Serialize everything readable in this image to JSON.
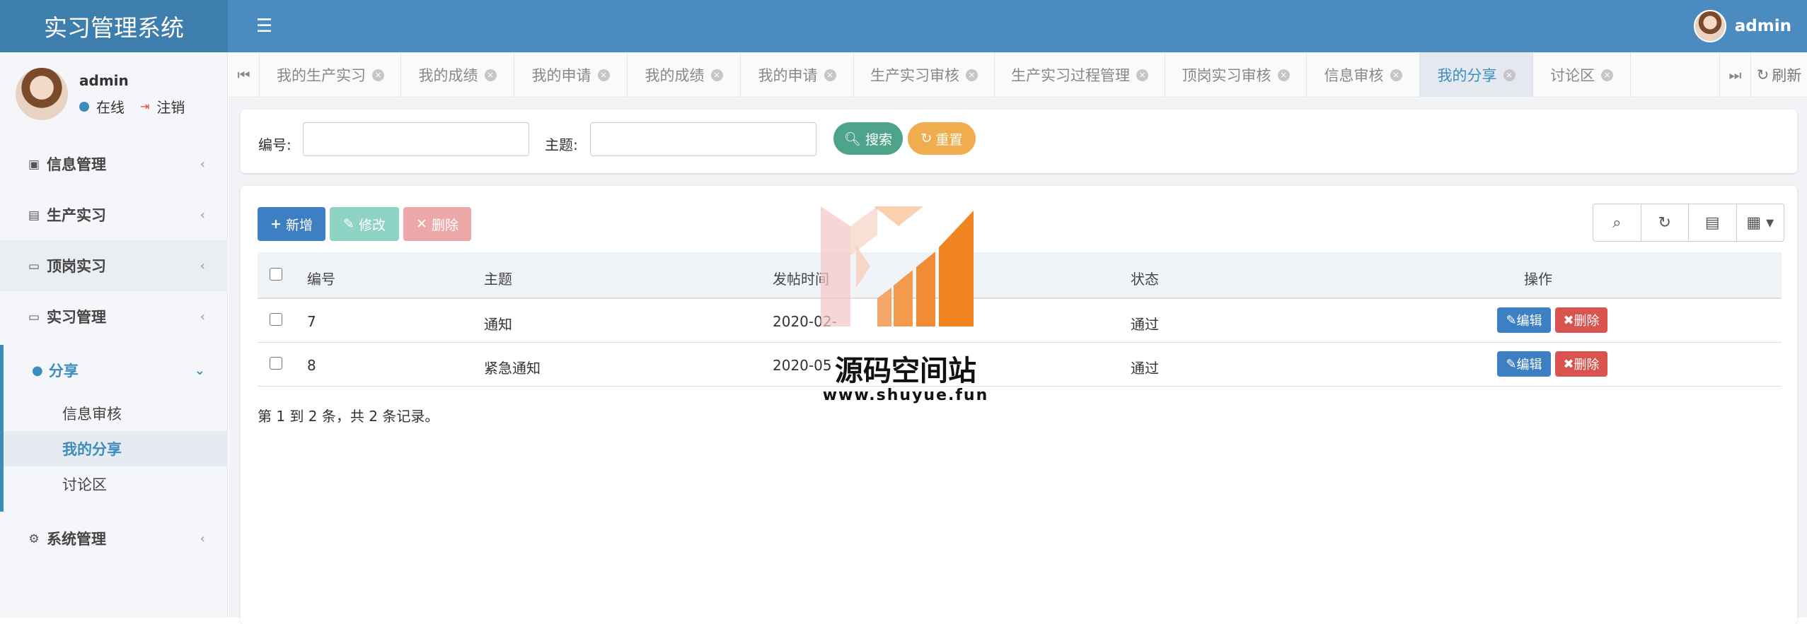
{
  "app": {
    "title": "实习管理系统",
    "user": "admin"
  },
  "sidebar": {
    "user_name": "admin",
    "online_label": "在线",
    "logout_label": "注销",
    "items": [
      {
        "label": "信息管理"
      },
      {
        "label": "生产实习"
      },
      {
        "label": "顶岗实习"
      },
      {
        "label": "实习管理"
      },
      {
        "label": "分享",
        "children": [
          {
            "label": "信息审核"
          },
          {
            "label": "我的分享"
          },
          {
            "label": "讨论区"
          }
        ]
      },
      {
        "label": "系统管理"
      }
    ]
  },
  "tabs": {
    "items": [
      {
        "label": "我的生产实习"
      },
      {
        "label": "我的成绩"
      },
      {
        "label": "我的申请"
      },
      {
        "label": "我的成绩"
      },
      {
        "label": "我的申请"
      },
      {
        "label": "生产实习审核"
      },
      {
        "label": "生产实习过程管理"
      },
      {
        "label": "顶岗实习审核"
      },
      {
        "label": "信息审核"
      },
      {
        "label": "我的分享"
      },
      {
        "label": "讨论区"
      }
    ],
    "active_index": 9,
    "refresh_label": "刷新"
  },
  "search": {
    "field1_label": "编号:",
    "field1_value": "",
    "field2_label": "主题:",
    "field2_value": "",
    "search_label": "搜索",
    "reset_label": "重置"
  },
  "toolbar": {
    "add_label": "新增",
    "edit_label": "修改",
    "delete_label": "删除"
  },
  "table": {
    "columns": [
      "编号",
      "主题",
      "发帖时间",
      "状态",
      "操作"
    ],
    "rows": [
      {
        "id": "7",
        "subject": "通知",
        "time": "2020-02-",
        "status": "通过"
      },
      {
        "id": "8",
        "subject": "紧急通知",
        "time": "2020-05",
        "status": "通过"
      }
    ],
    "row_edit_label": "编辑",
    "row_delete_label": "删除",
    "pagination": "第 1 到 2 条，共 2 条记录。"
  },
  "watermark": {
    "text": "源码空间站",
    "url": "www.shuyue.fun"
  },
  "colors": {
    "header": "#4c8bbf",
    "logo_bg": "#3e7eac",
    "accent": "#3c8dbc",
    "search_btn": "#4ea48a",
    "reset_btn": "#f0ad4e",
    "danger": "#d9534f"
  }
}
